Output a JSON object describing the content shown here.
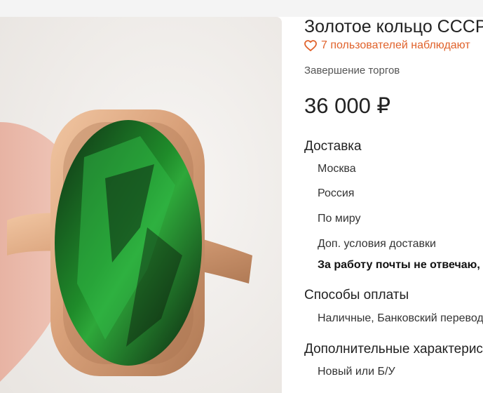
{
  "listing": {
    "title": "Золотое кольцо СССР",
    "watchers_text": "7 пользователей наблюдают",
    "end_label": "Завершение торгов",
    "price": "36 000 ₽",
    "photo_icon": "ring-photo"
  },
  "delivery": {
    "title": "Доставка",
    "items": [
      "Москва",
      "Россия",
      "По миру",
      "Доп. условия доставки"
    ],
    "note": "За работу почты не отвечаю,"
  },
  "payment": {
    "title": "Способы оплаты",
    "methods": "Наличные, Банковский перевод"
  },
  "extra": {
    "title": "Дополнительные характеристики",
    "condition": "Новый или Б/У"
  },
  "colors": {
    "accent": "#e0622b",
    "gem": "#1f8b2a",
    "gold": "#d9a17a"
  }
}
